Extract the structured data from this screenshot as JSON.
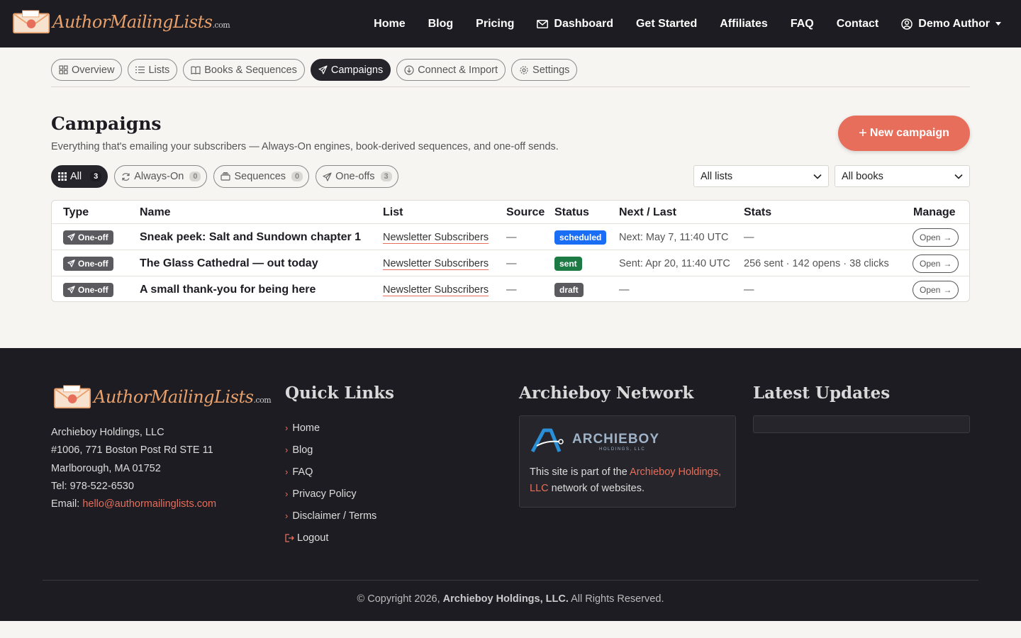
{
  "brand": {
    "name": "AuthorMailingLists",
    "tld": ".com"
  },
  "nav": {
    "items": [
      {
        "label": "Home"
      },
      {
        "label": "Blog"
      },
      {
        "label": "Pricing"
      },
      {
        "label": "Dashboard",
        "icon": "envelope-icon",
        "active": true
      },
      {
        "label": "Get Started"
      },
      {
        "label": "Affiliates"
      },
      {
        "label": "FAQ"
      },
      {
        "label": "Contact"
      }
    ],
    "user": {
      "label": "Demo Author",
      "icon": "user-circle-icon"
    }
  },
  "subtabs": [
    {
      "label": "Overview",
      "icon": "grid-icon"
    },
    {
      "label": "Lists",
      "icon": "list-icon"
    },
    {
      "label": "Books & Sequences",
      "icon": "book-icon"
    },
    {
      "label": "Campaigns",
      "icon": "send-icon",
      "active": true
    },
    {
      "label": "Connect & Import",
      "icon": "download-icon"
    },
    {
      "label": "Settings",
      "icon": "gear-icon"
    }
  ],
  "page": {
    "title": "Campaigns",
    "subtitle": "Everything that's emailing your subscribers — Always-On engines, book-derived sequences, and one-off sends.",
    "new_button": "New campaign"
  },
  "filters": [
    {
      "label": "All",
      "count": "3",
      "icon": "apps-icon",
      "active": true
    },
    {
      "label": "Always-On",
      "count": "0",
      "icon": "refresh-icon"
    },
    {
      "label": "Sequences",
      "count": "0",
      "icon": "stack-icon"
    },
    {
      "label": "One-offs",
      "count": "3",
      "icon": "send-icon"
    }
  ],
  "selects": {
    "lists": "All lists",
    "books": "All books"
  },
  "table": {
    "columns": [
      "Type",
      "Name",
      "List",
      "Source",
      "Status",
      "Next / Last",
      "Stats",
      "Manage"
    ],
    "rows": [
      {
        "type": "One-off",
        "name": "Sneak peek: Salt and Sundown chapter 1",
        "list": "Newsletter Subscribers",
        "source": "—",
        "status": "scheduled",
        "next_last": "Next: May 7, 11:40 UTC",
        "stats": "—",
        "manage": "Open"
      },
      {
        "type": "One-off",
        "name": "The Glass Cathedral — out today",
        "list": "Newsletter Subscribers",
        "source": "—",
        "status": "sent",
        "next_last": "Sent: Apr 20, 11:40 UTC",
        "stats": "256 sent · 142 opens · 38 clicks",
        "manage": "Open"
      },
      {
        "type": "One-off",
        "name": "A small thank-you for being here",
        "list": "Newsletter Subscribers",
        "source": "—",
        "status": "draft",
        "next_last": "—",
        "stats": "—",
        "manage": "Open"
      }
    ]
  },
  "status_colors": {
    "scheduled": "#1a6ef5",
    "sent": "#1e7a44",
    "draft": "#5b5b5f"
  },
  "accent": "#e76e5b",
  "footer": {
    "address_lines": [
      "Archieboy Holdings, LLC",
      "#1006, 771 Boston Post Rd STE 11",
      "Marlborough, MA 01752",
      "Tel: 978-522-6530"
    ],
    "email_label": "Email:",
    "email": "hello@authormailinglists.com",
    "quick_links_title": "Quick Links",
    "quick_links": [
      "Home",
      "Blog",
      "FAQ",
      "Privacy Policy",
      "Disclaimer / Terms"
    ],
    "logout": "Logout",
    "network_title": "Archieboy Network",
    "network_logo": "ARCHIEBOY",
    "network_logo_sub": "HOLDINGS, LLC",
    "network_text_pre": "This site is part of the",
    "network_link": "Archieboy Holdings, LLC",
    "network_text_post": "network of websites.",
    "updates_title": "Latest Updates",
    "copyright_pre": "© Copyright 2026,",
    "copyright_company": "Archieboy Holdings, LLC.",
    "copyright_post": "All Rights Reserved."
  }
}
